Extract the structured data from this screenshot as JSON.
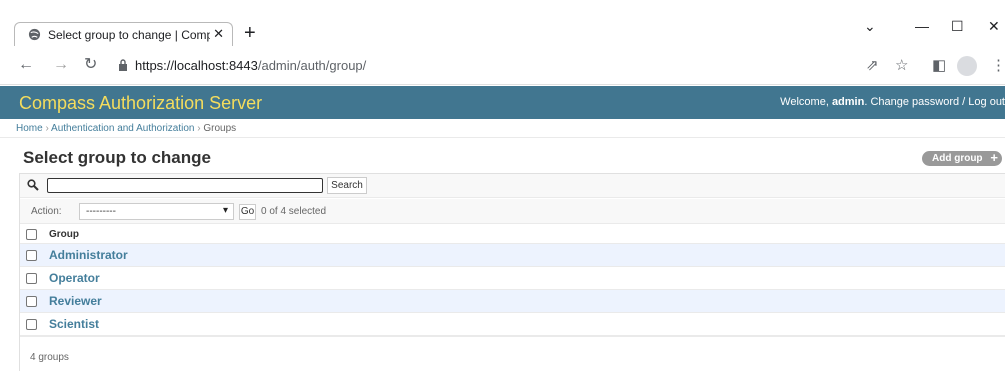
{
  "browser": {
    "tab_title": "Select group to change | Compass",
    "new_tab_glyph": "+",
    "url_scheme_host": "https://localhost:8443",
    "url_path": "/admin/auth/group/"
  },
  "header": {
    "branding": "Compass Authorization Server",
    "welcome": "Welcome, ",
    "username": "admin",
    "user_links": ". Change password / Log out"
  },
  "breadcrumbs": {
    "home": "Home",
    "sep": " › ",
    "section": "Authentication and Authorization",
    "current": "Groups"
  },
  "content": {
    "title": "Select group to change",
    "add_button": "Add group"
  },
  "search": {
    "value": "",
    "button": "Search"
  },
  "actions": {
    "label": "Action:",
    "selected": "---------",
    "go": "Go",
    "counter": "0 of 4 selected"
  },
  "table": {
    "column": "Group",
    "rows": [
      "Administrator",
      "Operator",
      "Reviewer",
      "Scientist"
    ]
  },
  "paginator": "4 groups",
  "colors": {
    "header_bg": "#417690",
    "branding": "#f5dd5d",
    "link": "#447e9b",
    "row_alt": "#edf3fe"
  },
  "icons": [
    "globe-icon",
    "close-icon",
    "back-arrow-icon",
    "forward-arrow-icon",
    "reload-icon",
    "lock-icon",
    "share-icon",
    "star-icon",
    "sidepanel-icon",
    "profile-icon",
    "menu-icon",
    "search-icon",
    "plus-icon"
  ]
}
